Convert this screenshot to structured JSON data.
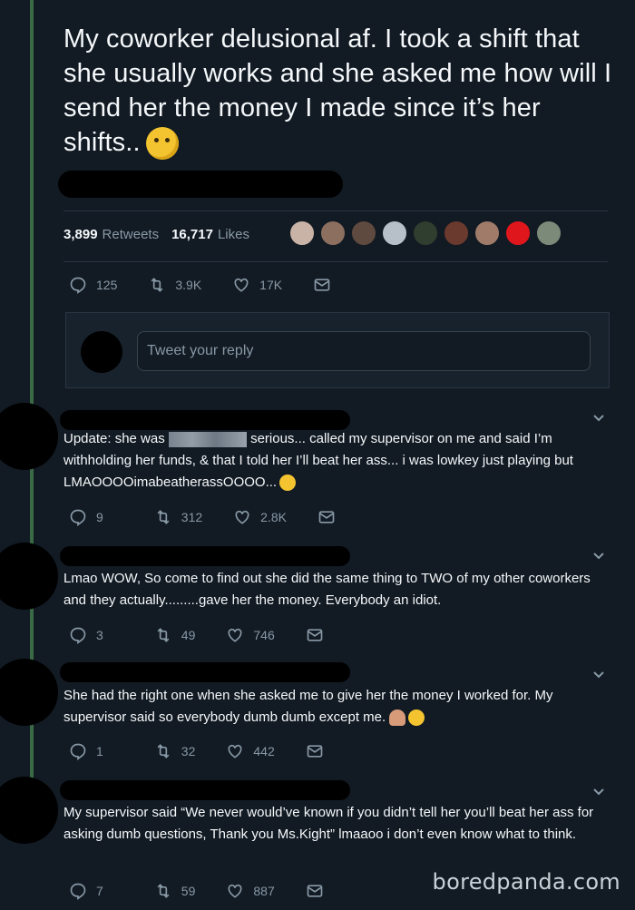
{
  "tweet": {
    "text": "My coworker delusional af. I took a shift that she usually works and she asked me how will I send her the money I made since it’s her shifts..",
    "retweets_count": "3,899",
    "retweets_label": "Retweets",
    "likes_count": "16,717",
    "likes_label": "Likes",
    "reply_count": "125",
    "retweet_short": "3.9K",
    "like_short": "17K"
  },
  "reply_box": {
    "placeholder": "Tweet your reply"
  },
  "replies": [
    {
      "text_before": "Update: she was",
      "text_after": "serious... called my supervisor on me and said I’m withholding her funds, & that I told her I’ll beat her ass... i was lowkey just playing but LMAOOOOimabeatherassOOOO...",
      "replies": "9",
      "retweets": "312",
      "likes": "2.8K"
    },
    {
      "text": "Lmao WOW, So come to find out she did the same thing to TWO of my other coworkers and they actually.........gave her the money. Everybody an idiot.",
      "replies": "3",
      "retweets": "49",
      "likes": "746"
    },
    {
      "text": "She had the right one when she asked me to give her the money I worked for. My supervisor said so everybody dumb dumb except me.",
      "replies": "1",
      "retweets": "32",
      "likes": "442"
    },
    {
      "text": "My supervisor said “We never would’ve known if you didn’t tell her you’ll beat her ass for asking dumb questions, Thank you Ms.Kight” lmaaoo i don’t even know what to think.",
      "replies": "7",
      "retweets": "59",
      "likes": "887"
    }
  ],
  "watermark": "boredpanda.com",
  "icons": [
    "reply-icon",
    "retweet-icon",
    "like-icon",
    "message-icon",
    "chevron-down-icon"
  ]
}
